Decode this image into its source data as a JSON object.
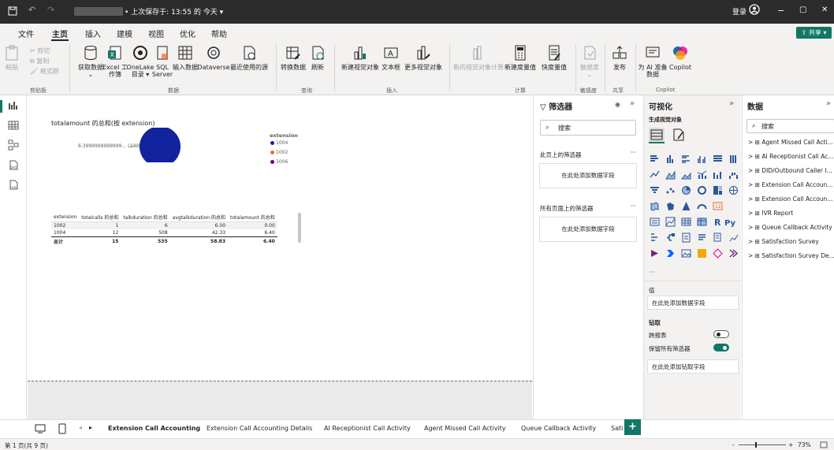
{
  "titlebar": {
    "save_status": "• 上次保存于: 13:55 的 今天 ▾",
    "login": "登录",
    "min": "−",
    "max": "▢",
    "close": "✕"
  },
  "menu": {
    "items": [
      "文件",
      "主页",
      "插入",
      "建模",
      "视图",
      "优化",
      "帮助"
    ],
    "share": "⇪ 共享 ▾"
  },
  "ribbon": {
    "cut": "✂ 剪切",
    "copy": "复制",
    "format": "格式刷",
    "paste": "粘贴",
    "get_data": "获取数据",
    "excel": "Excel 工作簿",
    "onelake": "OneLake 目录 ▾",
    "sql": "SQL Server",
    "enter_data": "输入数据",
    "dataverse": "Dataverse",
    "recent": "最近使用的源",
    "transform": "转换数据",
    "refresh": "刷新",
    "new_visual": "新建视觉对象",
    "textbox": "文本框",
    "more_visuals": "更多视觉对象",
    "new_calc": "新的视觉对象计算",
    "new_measure": "新建度量值",
    "quick_measure": "快度量值",
    "sensitivity": "敏感度",
    "publish": "发布",
    "copilot_prep": "为 AI 准备数据",
    "copilot": "Copilot",
    "groups": {
      "clipboard": "剪贴板",
      "data": "数据",
      "query": "查询",
      "insert": "插入",
      "calc": "计算",
      "sens": "敏感度",
      "share": "共享",
      "copilot": "Copilot"
    }
  },
  "chart": {
    "title": "totalamount 的总和(按 extension)",
    "pie_label": "6.3999999999999... (100%)",
    "legend_title": "extension",
    "legend": [
      "1004",
      "1002",
      "1006"
    ],
    "colors": {
      "c1004": "#12239e",
      "c1002": "#e66c37",
      "c1006": "#6b007b"
    }
  },
  "chart_data": {
    "type": "pie",
    "title": "totalamount 的总和(按 extension)",
    "categories": [
      "1004",
      "1002",
      "1006"
    ],
    "values": [
      6.4,
      0,
      0
    ],
    "labels": [
      "6.3999999999999... (100%)"
    ]
  },
  "table": {
    "headers": [
      "extension",
      "totalcalls 的总和",
      "talkduration 的总和",
      "avgtalkduration 的总和",
      "totalamount 的总和"
    ],
    "rows": [
      [
        "1002",
        "1",
        "6",
        "6.00",
        "0.00"
      ],
      [
        "1004",
        "12",
        "508",
        "42.33",
        "6.40"
      ]
    ],
    "total": [
      "总计",
      "15",
      "535",
      "58.83",
      "6.40"
    ]
  },
  "filters": {
    "title": "筛选器",
    "search": "搜索",
    "this_page": "此页上的筛选器",
    "all_pages": "所有页面上的筛选器",
    "add_field": "在此处添加数据字段",
    "more": "···"
  },
  "viz": {
    "title": "可视化",
    "build": "生成视觉对象",
    "values": "值",
    "add_field": "在此处添加数据字段",
    "drill": "钻取",
    "cross_report": "跨报表",
    "keep_filters": "保留所有筛选器",
    "add_drill": "在此处添加钻取字段",
    "ellipsis": "···"
  },
  "data": {
    "title": "数据",
    "search": "搜索",
    "tables": [
      "Agent Missed Call Acti...",
      "AI Receptionist Call Ac...",
      "DID/Outbound Caller I...",
      "Extension Call Accoun...",
      "Extension Call Accoun...",
      "IVR Report",
      "Queue Callback Activity",
      "Satisfaction Survey",
      "Satisfaction Survey De..."
    ]
  },
  "tabs": {
    "items": [
      "Extension Call Accounting",
      "Extension Call Accounting Details",
      "AI Receptionist Call Activity",
      "Agent Missed Call Activity",
      "Queue Callback Activity",
      "Sati"
    ],
    "add": "+"
  },
  "status": {
    "page": "第 1 页(共 9 页)",
    "zoom": "73%",
    "zoom_level": 0.73
  }
}
